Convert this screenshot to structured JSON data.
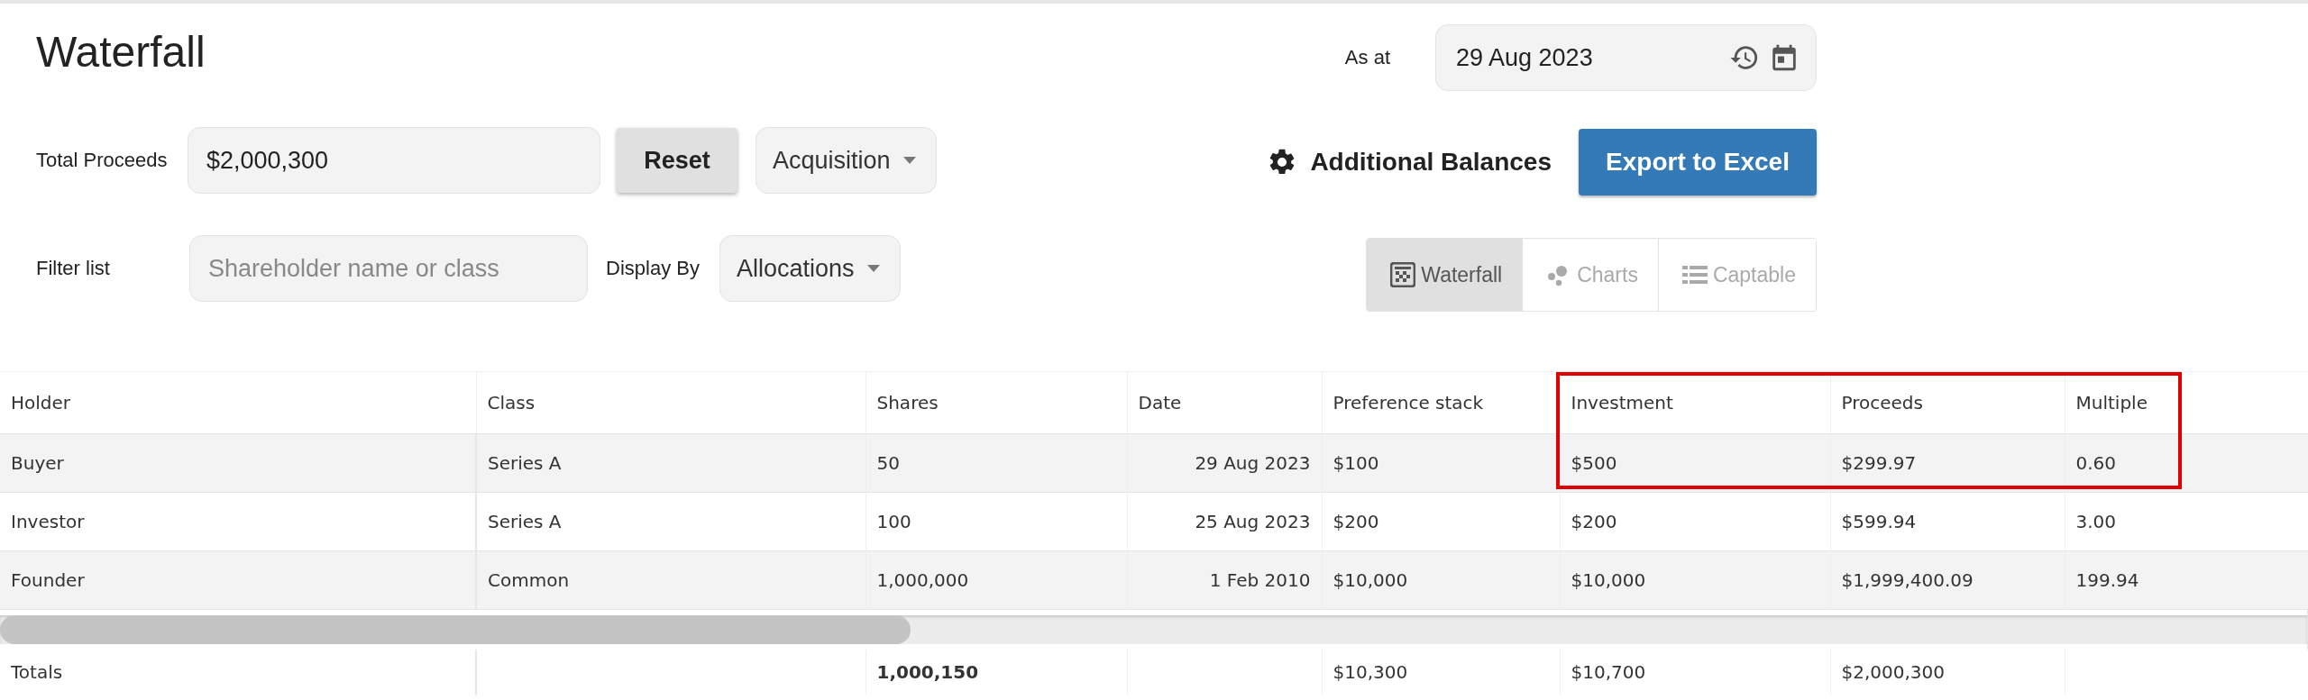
{
  "page": {
    "title": "Waterfall"
  },
  "as_at": {
    "label": "As at",
    "value": "29 Aug 2023"
  },
  "proceeds": {
    "label": "Total Proceeds",
    "value": "$2,000,300",
    "reset": "Reset",
    "scenario": "Acquisition"
  },
  "actions": {
    "additional_balances": "Additional Balances",
    "export": "Export to Excel"
  },
  "filter": {
    "label": "Filter list",
    "placeholder": "Shareholder name or class",
    "display_label": "Display By",
    "display_value": "Allocations"
  },
  "views": [
    {
      "kind": "waterfall",
      "label": "Waterfall",
      "selected": true
    },
    {
      "kind": "charts",
      "label": "Charts",
      "selected": false
    },
    {
      "kind": "captable",
      "label": "Captable",
      "selected": false
    }
  ],
  "table": {
    "columns": [
      "Holder",
      "Class",
      "Shares",
      "Date",
      "Preference stack",
      "Investment",
      "Proceeds",
      "Multiple"
    ],
    "rows": [
      {
        "holder": "Buyer",
        "class": "Series A",
        "shares": "50",
        "date": "29 Aug 2023",
        "preference": "$100",
        "investment": "$500",
        "proceeds": "$299.97",
        "multiple": "0.60"
      },
      {
        "holder": "Investor",
        "class": "Series A",
        "shares": "100",
        "date": "25 Aug 2023",
        "preference": "$200",
        "investment": "$200",
        "proceeds": "$599.94",
        "multiple": "3.00"
      },
      {
        "holder": "Founder",
        "class": "Common",
        "shares": "1,000,000",
        "date": "1 Feb 2010",
        "preference": "$10,000",
        "investment": "$10,000",
        "proceeds": "$1,999,400.09",
        "multiple": "199.94"
      }
    ],
    "totals": {
      "holder": "Totals",
      "shares": "1,000,150",
      "preference": "$10,300",
      "investment": "$10,700",
      "proceeds": "$2,000,300"
    }
  }
}
